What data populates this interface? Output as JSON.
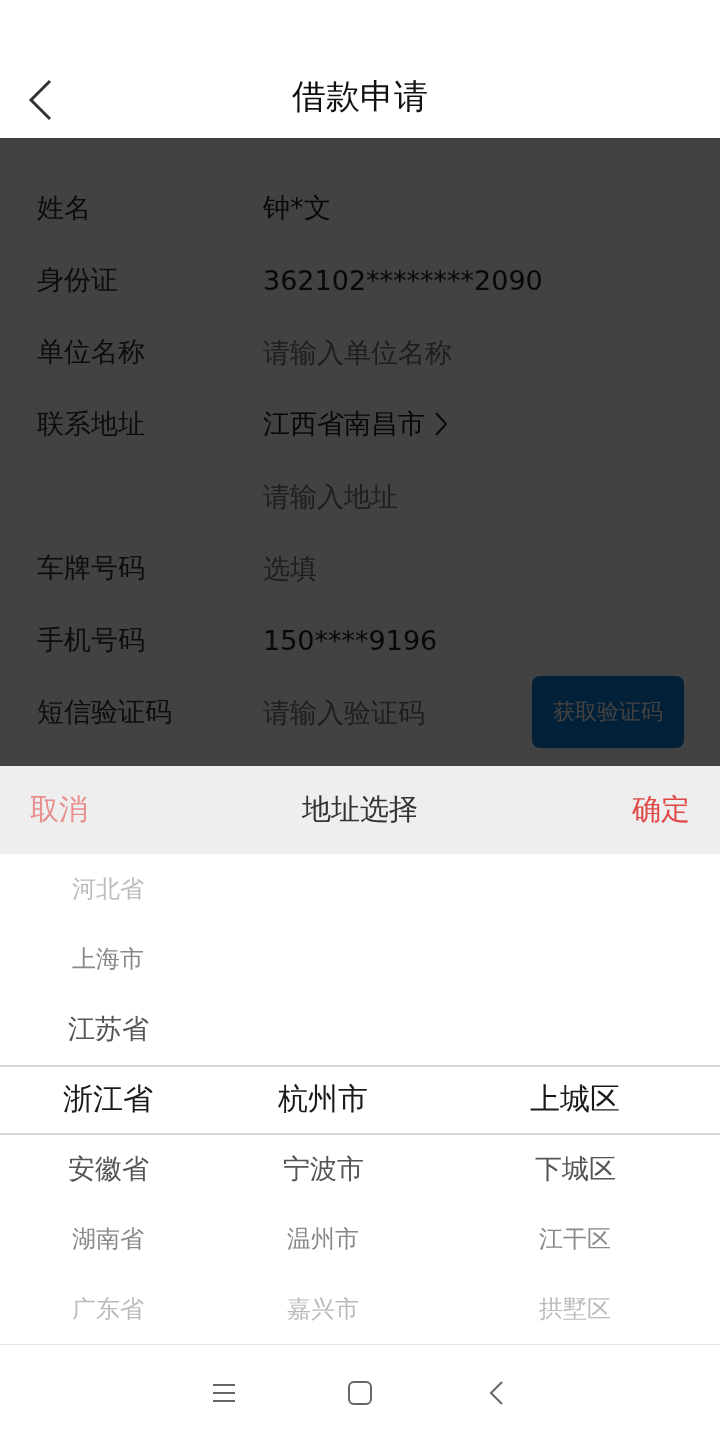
{
  "header": {
    "title": "借款申请"
  },
  "form": {
    "rows": [
      {
        "kind": "text",
        "label": "姓名",
        "value": "钟*文"
      },
      {
        "kind": "text",
        "label": "身份证",
        "value": "362102********2090"
      },
      {
        "kind": "input",
        "label": "单位名称",
        "placeholder": "请输入单位名称"
      },
      {
        "kind": "select",
        "label": "联系地址",
        "value": "江西省南昌市"
      },
      {
        "kind": "input",
        "placeholder": "请输入地址"
      },
      {
        "kind": "input",
        "label": "车牌号码",
        "placeholder": "选填"
      },
      {
        "kind": "text",
        "label": "手机号码",
        "value": "150****9196"
      },
      {
        "kind": "code",
        "label": "短信验证码",
        "placeholder": "请输入验证码",
        "button": "获取验证码"
      }
    ]
  },
  "picker": {
    "cancel": "取消",
    "title": "地址选择",
    "confirm": "确定",
    "columns": [
      {
        "items": [
          {
            "label": "河北省",
            "selected": false
          },
          {
            "label": "上海市",
            "selected": false
          },
          {
            "label": "江苏省",
            "selected": false
          },
          {
            "label": "浙江省",
            "selected": true
          },
          {
            "label": "安徽省",
            "selected": false
          },
          {
            "label": "湖南省",
            "selected": false
          },
          {
            "label": "广东省",
            "selected": false
          }
        ]
      },
      {
        "items": [
          {
            "label": "杭州市",
            "selected": true
          },
          {
            "label": "宁波市",
            "selected": false
          },
          {
            "label": "温州市",
            "selected": false
          },
          {
            "label": "嘉兴市",
            "selected": false
          }
        ]
      },
      {
        "items": [
          {
            "label": "上城区",
            "selected": true
          },
          {
            "label": "下城区",
            "selected": false
          },
          {
            "label": "江干区",
            "selected": false
          },
          {
            "label": "拱墅区",
            "selected": false
          }
        ]
      }
    ]
  }
}
